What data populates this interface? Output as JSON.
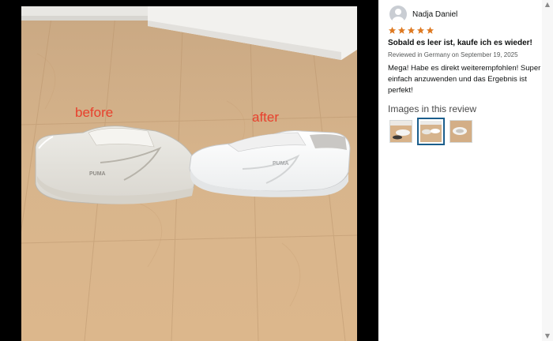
{
  "photo": {
    "label_before": "before",
    "label_after": "after",
    "brand_left": "PUMA",
    "brand_right": "PUMA"
  },
  "review": {
    "reviewer_name": "Nadja Daniel",
    "rating": 5,
    "star_color": "#de7921",
    "title": "Sobald es leer ist, kaufe ich es wieder!",
    "meta": "Reviewed in Germany on September 19, 2025",
    "body": "Mega! Habe es direkt weiterempfohlen! Super einfach anzuwenden und das Ergebnis ist perfekt!"
  },
  "images_section": {
    "heading": "Images in this review",
    "thumbnails": [
      {
        "name": "thumbnail-1",
        "selected": false
      },
      {
        "name": "thumbnail-2",
        "selected": true
      },
      {
        "name": "thumbnail-3",
        "selected": false
      }
    ]
  },
  "scrollbar": {
    "up_icon": "▲",
    "down_icon": "▼"
  },
  "colors": {
    "annotation_red": "#e8402d",
    "selected_border": "#1b5e8c"
  }
}
